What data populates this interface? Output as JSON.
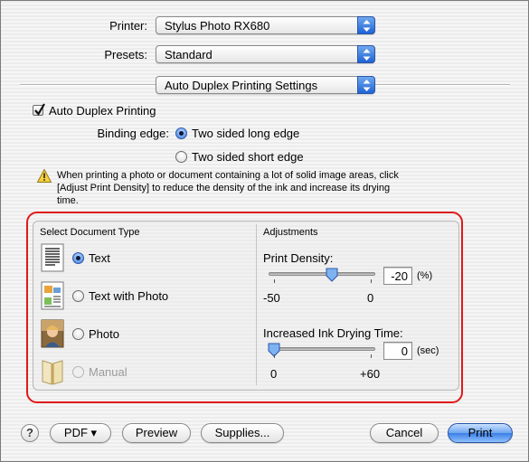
{
  "printer": {
    "label": "Printer:",
    "value": "Stylus Photo RX680"
  },
  "presets": {
    "label": "Presets:",
    "value": "Standard"
  },
  "panel": {
    "value": "Auto Duplex Printing Settings"
  },
  "auto_duplex": {
    "label": "Auto Duplex Printing",
    "checked": true
  },
  "binding": {
    "label": "Binding edge:",
    "options": [
      "Two sided long edge",
      "Two sided short edge"
    ],
    "selected": "Two sided long edge"
  },
  "warning": {
    "lines": [
      "When printing a photo or document containing a lot of solid image areas, click",
      "[Adjust Print Density] to reduce the density of the ink and increase its drying",
      "time."
    ]
  },
  "document_type": {
    "title": "Select Document Type",
    "options": [
      "Text",
      "Text with Photo",
      "Photo",
      "Manual"
    ],
    "selected": "Text",
    "disabled": [
      "Manual"
    ]
  },
  "adjustments": {
    "title": "Adjustments",
    "print_density": {
      "label": "Print Density:",
      "value": "-20",
      "unit": "(%)",
      "min_label": "-50",
      "max_label": "0",
      "current": -20,
      "min": -50,
      "max": 0
    },
    "drying_time": {
      "label": "Increased Ink Drying Time:",
      "value": "0",
      "unit": "(sec)",
      "min_label": "0",
      "max_label": "+60",
      "current": 0,
      "min": 0,
      "max": 60
    }
  },
  "footer": {
    "help": "?",
    "pdf": "PDF ▾",
    "preview": "Preview",
    "supplies": "Supplies...",
    "cancel": "Cancel",
    "print": "Print"
  }
}
